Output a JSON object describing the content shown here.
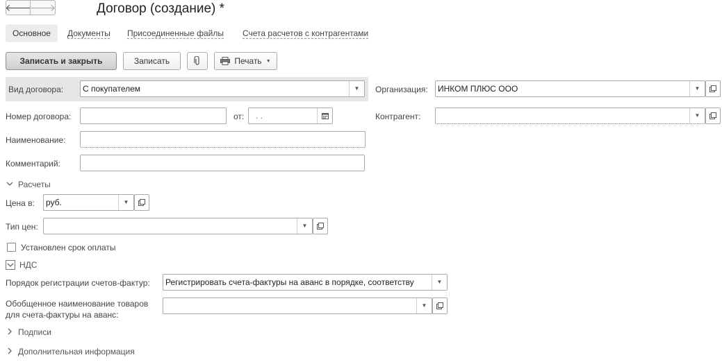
{
  "nav": {
    "back": "🡐",
    "forward": "🡒"
  },
  "title": "Договор (создание) *",
  "tabs": [
    {
      "label": "Основное"
    },
    {
      "label": "Документы"
    },
    {
      "label": "Присоединенные файлы"
    },
    {
      "label": "Счета расчетов с контрагентами"
    }
  ],
  "toolbar": {
    "save_close": "Записать и закрыть",
    "save": "Записать",
    "print": "Печать"
  },
  "form": {
    "contract_type": {
      "label": "Вид договора:",
      "value": "С покупателем"
    },
    "organization": {
      "label": "Организация:",
      "value": "ИНКОМ ПЛЮС ООО"
    },
    "contract_number": {
      "label": "Номер договора:",
      "value": ""
    },
    "date": {
      "label": "от:",
      "value": " .  ."
    },
    "counterparty": {
      "label": "Контрагент:",
      "value": ""
    },
    "name": {
      "label": "Наименование:",
      "value": ""
    },
    "comment": {
      "label": "Комментарий:",
      "value": ""
    }
  },
  "settlements": {
    "group": "Расчеты",
    "price_in": {
      "label": "Цена в:",
      "value": "руб."
    },
    "price_type": {
      "label": "Тип цен:",
      "value": ""
    },
    "payment_term": {
      "label": "Установлен срок оплаты",
      "checked": false
    }
  },
  "vat": {
    "group": "НДС",
    "invoice_order": {
      "label": "Порядок регистрации счетов-фактур:",
      "value": "Регистрировать счета-фактуры на аванс в порядке, соответству"
    },
    "generic_name": {
      "label_line1": "Обобщенное наименование товаров",
      "label_line2": "для счета-фактуры на аванс:",
      "value": ""
    }
  },
  "groups": {
    "signatures": "Подписи",
    "additional": "Дополнительная информация"
  }
}
